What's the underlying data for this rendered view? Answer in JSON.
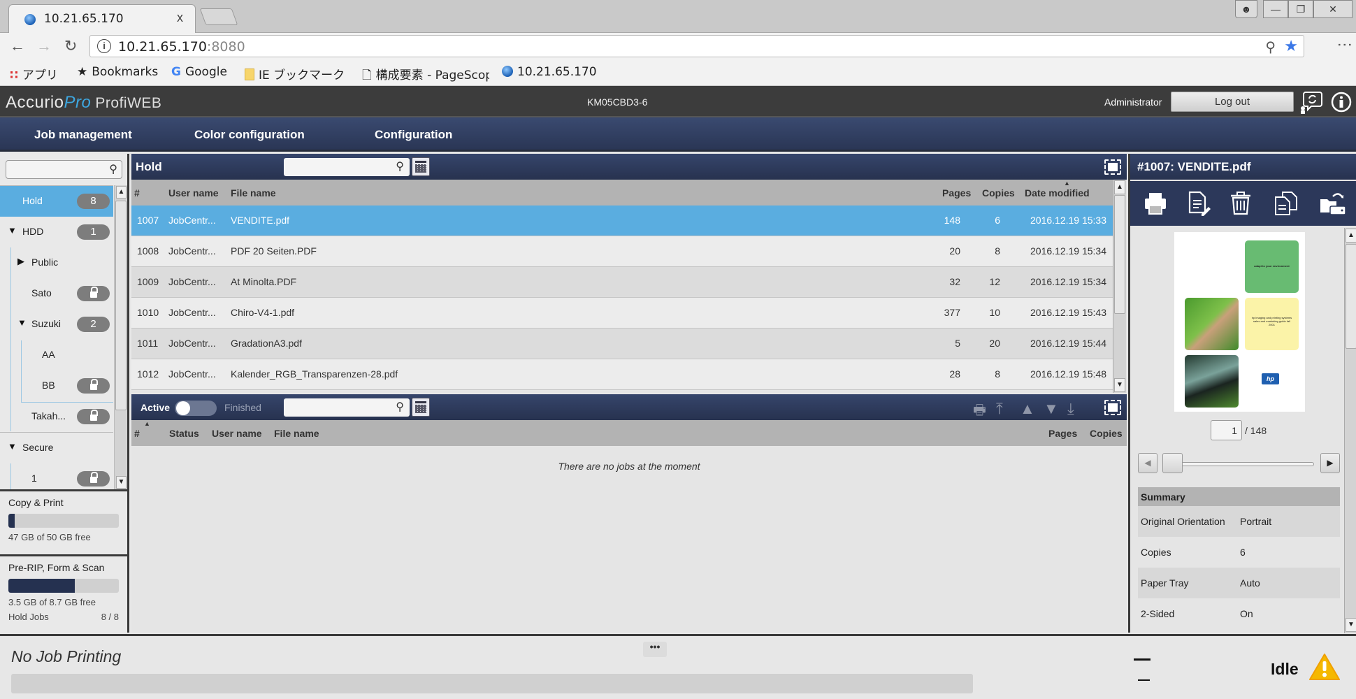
{
  "browser": {
    "tab_title": "10.21.65.170",
    "tab_close": "x",
    "url_host": "10.21.65.170",
    "url_port": ":8080",
    "bookmarks": [
      {
        "label": "アプリ",
        "icon": "apps-grid-icon"
      },
      {
        "label": "Bookmarks",
        "icon": "star-icon"
      },
      {
        "label": "Google",
        "icon": "google-icon"
      },
      {
        "label": "IE ブックマーク",
        "icon": "folder-icon"
      },
      {
        "label": "構成要素 - PageScop",
        "icon": "page-icon"
      },
      {
        "label": "10.21.65.170",
        "icon": "globe-icon"
      }
    ]
  },
  "app": {
    "logo_main": "Accurio",
    "logo_pro": "Pro",
    "logo_product": "ProfiWEB",
    "device_name": "KM05CBD3-6",
    "user": "Administrator",
    "logout_label": "Log out"
  },
  "nav": {
    "items": [
      "Job management",
      "Color configuration",
      "Configuration"
    ]
  },
  "sidebar": {
    "search_placeholder": "",
    "tree": [
      {
        "label": "Hold",
        "badge": "8",
        "selected": true
      },
      {
        "label": "HDD",
        "badge": "1",
        "caret": "▼"
      },
      {
        "label": "Public",
        "caret": "▶"
      },
      {
        "label": "Sato",
        "locked": true
      },
      {
        "label": "Suzuki",
        "badge": "2",
        "caret": "▼"
      },
      {
        "label": "AA"
      },
      {
        "label": "BB",
        "locked": true
      },
      {
        "label": "Takah...",
        "locked": true
      },
      {
        "label": "Secure",
        "caret": "▼"
      },
      {
        "label": "1",
        "locked": true
      }
    ],
    "storage": [
      {
        "title": "Copy & Print",
        "free_text": "47 GB of 50 GB free",
        "used_fraction": 0.06
      },
      {
        "title": "Pre-RIP, Form & Scan",
        "free_text": "3.5 GB of 8.7 GB free",
        "used_fraction": 0.6,
        "hold_jobs_label": "Hold Jobs",
        "hold_jobs_value": "8 / 8"
      }
    ]
  },
  "hold_panel": {
    "title": "Hold",
    "search_placeholder": "",
    "columns": {
      "num": "#",
      "user": "User name",
      "file": "File name",
      "pages": "Pages",
      "copies": "Copies",
      "date": "Date modified"
    },
    "rows": [
      {
        "num": "1007",
        "user": "JobCentr...",
        "file": "VENDITE.pdf",
        "pages": "148",
        "copies": "6",
        "date": "2016.12.19 15:33",
        "selected": true
      },
      {
        "num": "1008",
        "user": "JobCentr...",
        "file": "PDF 20 Seiten.PDF",
        "pages": "20",
        "copies": "8",
        "date": "2016.12.19 15:34"
      },
      {
        "num": "1009",
        "user": "JobCentr...",
        "file": "At Minolta.PDF",
        "pages": "32",
        "copies": "12",
        "date": "2016.12.19 15:34"
      },
      {
        "num": "1010",
        "user": "JobCentr...",
        "file": "Chiro-V4-1.pdf",
        "pages": "377",
        "copies": "10",
        "date": "2016.12.19 15:43"
      },
      {
        "num": "1011",
        "user": "JobCentr...",
        "file": "GradationA3.pdf",
        "pages": "5",
        "copies": "20",
        "date": "2016.12.19 15:44"
      },
      {
        "num": "1012",
        "user": "JobCentr...",
        "file": "Kalender_RGB_Transparenzen-28.pdf",
        "pages": "28",
        "copies": "8",
        "date": "2016.12.19 15:48"
      }
    ]
  },
  "active_panel": {
    "toggle_left": "Active",
    "toggle_right": "Finished",
    "search_placeholder": "",
    "columns": {
      "num": "#",
      "status": "Status",
      "user": "User name",
      "file": "File name",
      "pages": "Pages",
      "copies": "Copies"
    },
    "empty_message": "There are no jobs at the moment"
  },
  "detail": {
    "title": "#1007: VENDITE.pdf",
    "tools": [
      "print-icon",
      "edit-document-icon",
      "trash-icon",
      "copy-documents-icon",
      "move-to-storage-icon"
    ],
    "preview_text_green": "adapt to your environment",
    "preview_text_yellow": "hp imaging and printing systems sales and marketing guide fall 2001",
    "current_page": "1",
    "total_pages": "/ 148",
    "summary_title": "Summary",
    "summary": [
      {
        "key": "Original Orientation",
        "value": "Portrait"
      },
      {
        "key": "Copies",
        "value": "6"
      },
      {
        "key": "Paper Tray",
        "value": "Auto"
      },
      {
        "key": "2-Sided",
        "value": "On"
      }
    ]
  },
  "status": {
    "job_status": "No Job Printing",
    "more": "•••",
    "machine_state": "Idle",
    "warning_color": "#f5b800"
  }
}
